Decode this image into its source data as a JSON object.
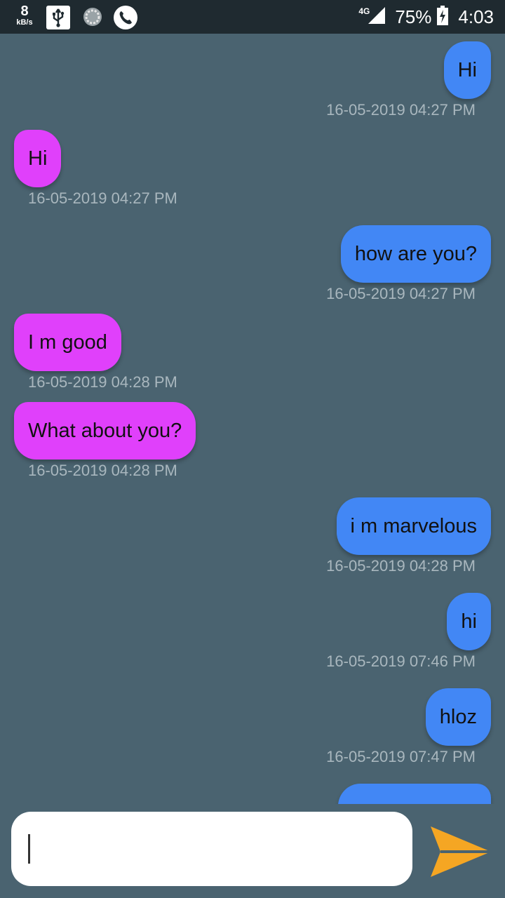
{
  "status_bar": {
    "net_speed_value": "8",
    "net_speed_unit": "kB/s",
    "network_type": "4G",
    "battery_percent": "75%",
    "time": "4:03",
    "icons": [
      "usb-icon",
      "sync-icon",
      "phone-icon",
      "signal-icon",
      "battery-charging-icon"
    ]
  },
  "messages": [
    {
      "side": "sent",
      "text": "Hi",
      "timestamp": "16-05-2019 04:27 PM"
    },
    {
      "side": "recv",
      "text": "Hi",
      "timestamp": "16-05-2019 04:27 PM"
    },
    {
      "side": "sent",
      "text": "how are you?",
      "timestamp": "16-05-2019 04:27 PM"
    },
    {
      "side": "recv",
      "text": "I m good",
      "timestamp": "16-05-2019 04:28 PM"
    },
    {
      "side": "recv",
      "text": "What about you?",
      "timestamp": "16-05-2019 04:28 PM"
    },
    {
      "side": "sent",
      "text": "i m marvelous",
      "timestamp": "16-05-2019 04:28 PM"
    },
    {
      "side": "sent",
      "text": "hi",
      "timestamp": "16-05-2019 07:46 PM"
    },
    {
      "side": "sent",
      "text": "hloz",
      "timestamp": "16-05-2019 07:47 PM"
    },
    {
      "side": "sent",
      "text": "",
      "timestamp": ""
    }
  ],
  "composer": {
    "input_value": "",
    "send_icon": "send-icon"
  },
  "colors": {
    "background": "#4a6370",
    "sent_bubble": "#4287f5",
    "received_bubble": "#e040fb",
    "timestamp": "#a9b7be",
    "send_button": "#f5a623"
  }
}
